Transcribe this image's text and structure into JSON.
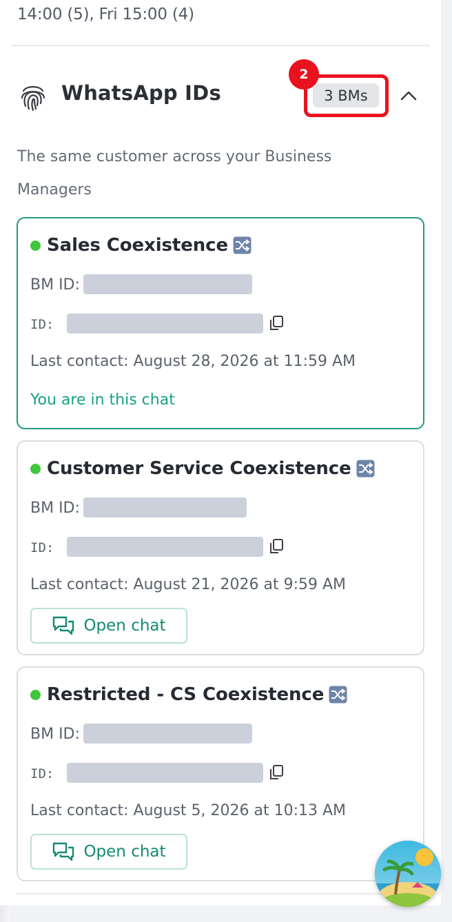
{
  "schedule_text": "14:00 (5), Fri 15:00 (4)",
  "section": {
    "title": "WhatsApp IDs",
    "icon": "fingerprint-icon",
    "badge": "3 BMs",
    "annotation_number": "2",
    "description": "The same customer across your Business Managers",
    "toggle_icon": "chevron-up-icon"
  },
  "cards": [
    {
      "name": "Sales Coexistence",
      "status_color": "#3fc63d",
      "bm_id_label": "BM ID:",
      "id_label": "ID:",
      "last_contact": "Last contact: August 28, 2026 at 11:59 AM",
      "in_chat_text": "You are in this chat",
      "active": true
    },
    {
      "name": "Customer Service Coexistence",
      "status_color": "#3fc63d",
      "bm_id_label": "BM ID:",
      "id_label": "ID:",
      "last_contact": "Last contact: August 21, 2026 at 9:59 AM",
      "button_label": "Open chat",
      "active": false
    },
    {
      "name": "Restricted - CS Coexistence",
      "status_color": "#3fc63d",
      "bm_id_label": "BM ID:",
      "id_label": "ID:",
      "last_contact": "Last contact: August 5, 2026 at 10:13 AM",
      "button_label": "Open chat",
      "active": false
    }
  ],
  "colors": {
    "accent_teal": "#1b9a82",
    "annotation_red": "#e8131f",
    "status_green": "#3fc63d"
  }
}
